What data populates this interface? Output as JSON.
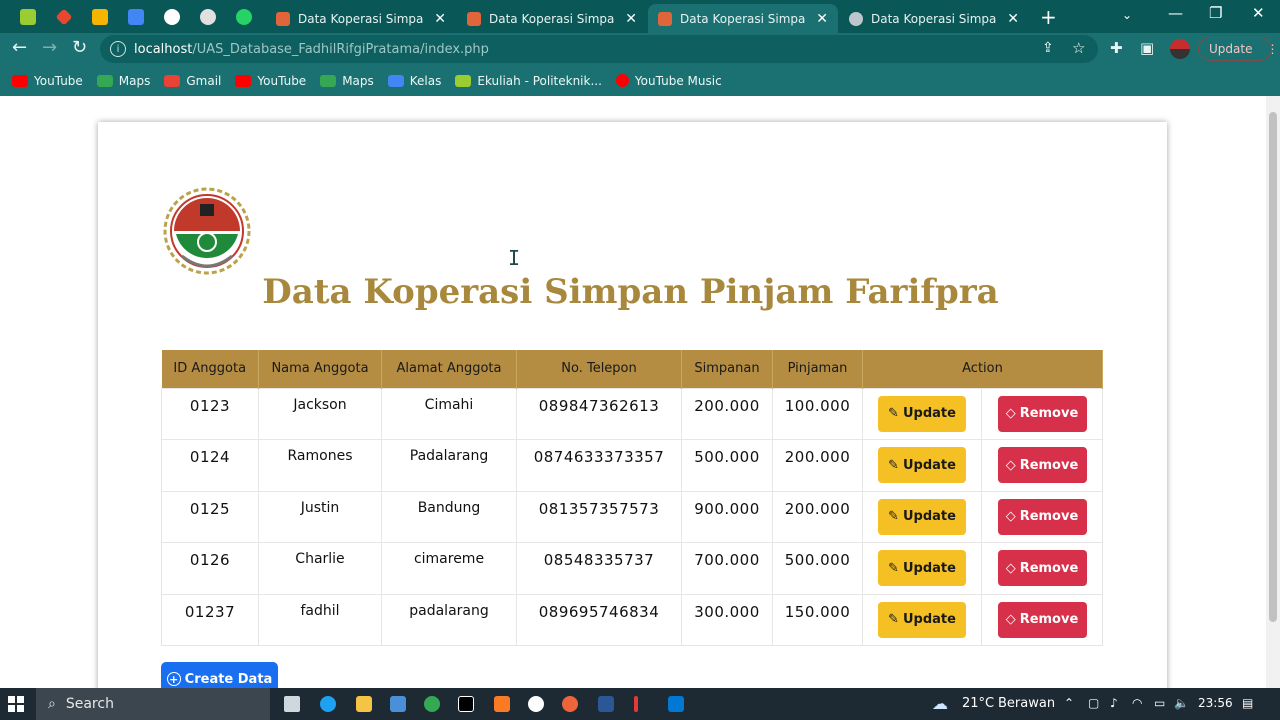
{
  "browser": {
    "tabs": [
      {
        "title": "Data Koperasi Simpan Pinjam Farifpra",
        "active": false
      },
      {
        "title": "Data Koperasi Simpan Pinjam Farifpra",
        "active": false
      },
      {
        "title": "Data Koperasi Simpan Pinjam Farifpra",
        "active": true
      },
      {
        "title": "Data Koperasi Simpan Pinjam Farifpra",
        "active": false
      }
    ],
    "url_host": "localhost",
    "url_path": "/UAS_Database_FadhilRifgiPratama/index.php",
    "update_label": "Update",
    "bookmarks": [
      "YouTube",
      "Maps",
      "Gmail",
      "YouTube",
      "Maps",
      "Kelas",
      "Ekuliah - Politeknik...",
      "YouTube Music"
    ]
  },
  "page": {
    "title": "Data Koperasi Simpan Pinjam Farifpra",
    "table": {
      "headers": [
        "ID Anggota",
        "Nama Anggota",
        "Alamat Anggota",
        "No. Telepon",
        "Simpanan",
        "Pinjaman",
        "Action"
      ],
      "rows": [
        {
          "id": "0123",
          "nama": "Jackson",
          "alamat": "Cimahi",
          "telepon": "089847362613",
          "simpanan": "200.000",
          "pinjaman": "100.000"
        },
        {
          "id": "0124",
          "nama": "Ramones",
          "alamat": "Padalarang",
          "telepon": "0874633373357",
          "simpanan": "500.000",
          "pinjaman": "200.000"
        },
        {
          "id": "0125",
          "nama": "Justin",
          "alamat": "Bandung",
          "telepon": "081357357573",
          "simpanan": "900.000",
          "pinjaman": "200.000"
        },
        {
          "id": "0126",
          "nama": "Charlie",
          "alamat": "cimareme",
          "telepon": "08548335737",
          "simpanan": "700.000",
          "pinjaman": "500.000"
        },
        {
          "id": "01237",
          "nama": "fadhil",
          "alamat": "padalarang",
          "telepon": "089695746834",
          "simpanan": "300.000",
          "pinjaman": "150.000"
        }
      ],
      "update_label": "Update",
      "remove_label": "Remove"
    },
    "create_label": "Create Data"
  },
  "taskbar": {
    "search_label": "Search",
    "weather": "21°C",
    "weather_text": "Berawan",
    "time": "23:56"
  },
  "colors": {
    "chrome_dark": "#0a5757",
    "chrome_toolbar": "#1b7171",
    "title_gold": "#a8883d",
    "table_header": "#b48c42",
    "update_yellow": "#f4c024",
    "remove_red": "#d6304a",
    "create_blue": "#1a6ff0"
  }
}
